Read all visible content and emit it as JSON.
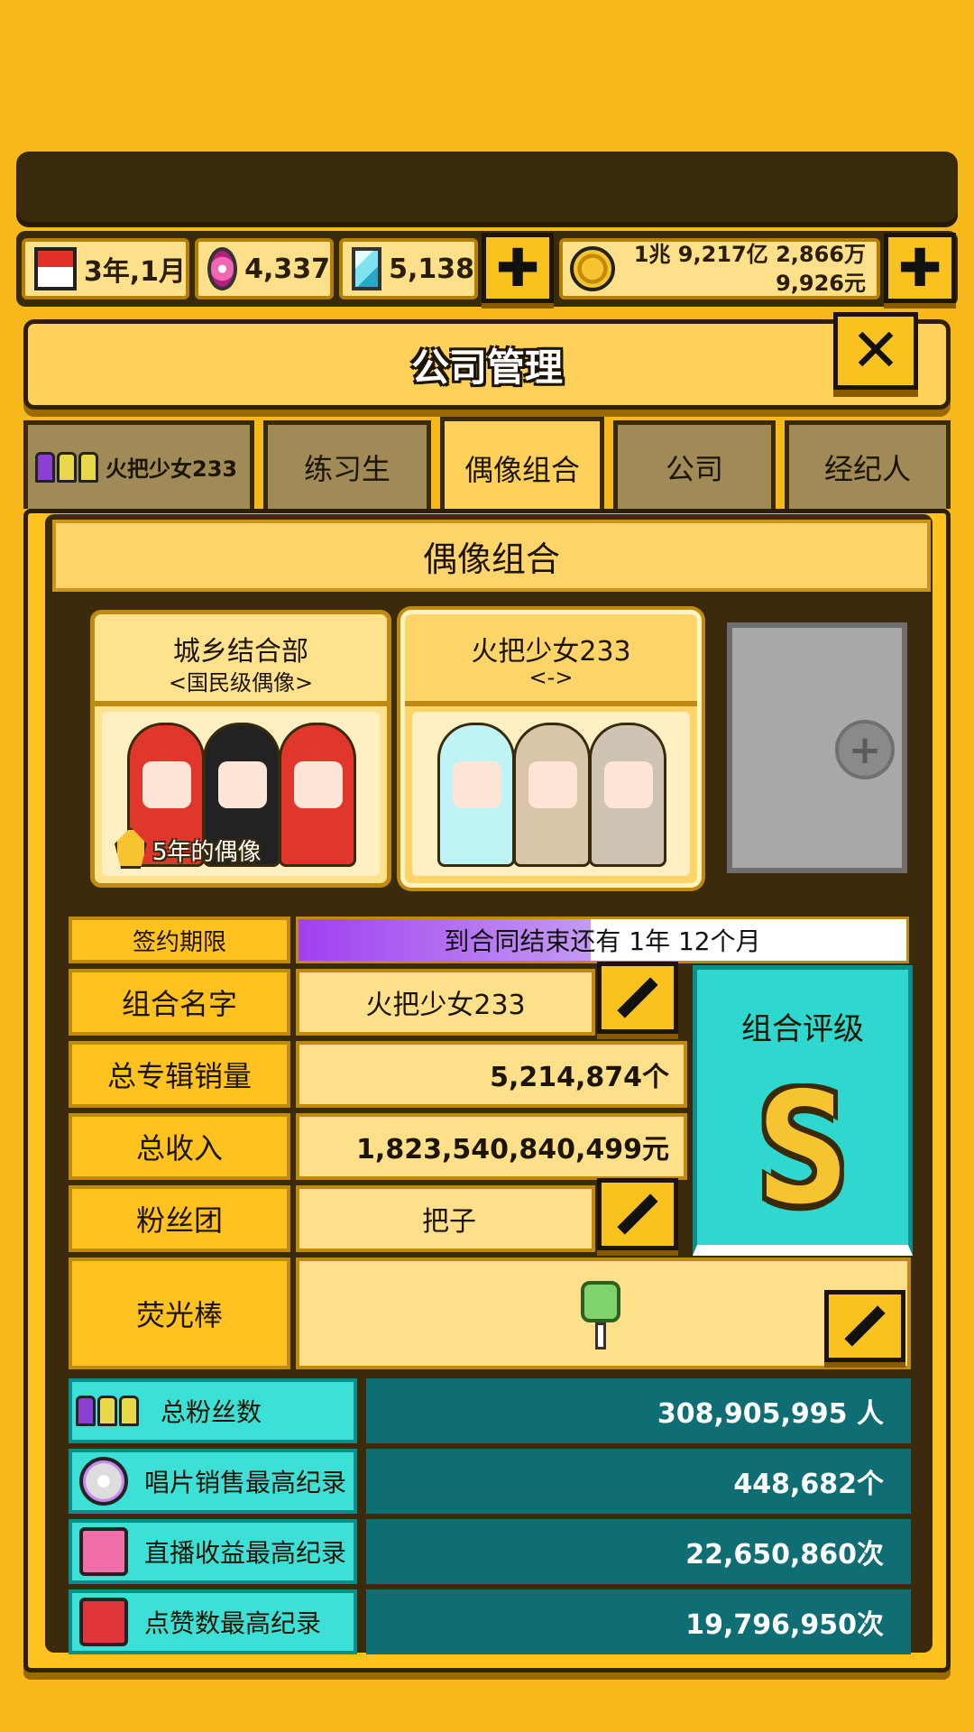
{
  "resources": {
    "date": "3年,1月",
    "gems": "4,337",
    "diamonds": "5,138",
    "money_line1": "1兆 9,217亿 2,866万",
    "money_line2": "9,926元",
    "plus": "✚"
  },
  "window": {
    "title": "公司管理",
    "close": "✕"
  },
  "tabs": [
    {
      "label": "火把少女233"
    },
    {
      "label": "练习生"
    },
    {
      "label": "偶像组合"
    },
    {
      "label": "公司"
    },
    {
      "label": "经纪人"
    }
  ],
  "section_title": "偶像组合",
  "groups": [
    {
      "name": "城乡结合部",
      "rank": "<国民级偶像>",
      "badge": "5年的偶像"
    },
    {
      "name": "火把少女233",
      "rank": "<->"
    }
  ],
  "empty_slot": "+",
  "contract": {
    "label": "签约期限",
    "text": "到合同结束还有 1年 12个月",
    "remaining_fraction": 0.48
  },
  "info": {
    "group_name_label": "组合名字",
    "group_name_value": "火把少女233",
    "album_sales_label": "总专辑销量",
    "album_sales_value": "5,214,874个",
    "income_label": "总收入",
    "income_value": "1,823,540,840,499元",
    "fanclub_label": "粉丝团",
    "fanclub_value": "把子",
    "lightstick_label": "荧光棒"
  },
  "rating": {
    "label": "组合评级",
    "grade": "S"
  },
  "stats": [
    {
      "label": "总粉丝数",
      "value": "308,905,995 人"
    },
    {
      "label": "唱片销售最高纪录",
      "value": "448,682个"
    },
    {
      "label": "直播收益最高纪录",
      "value": "22,650,860次"
    },
    {
      "label": "点赞数最高纪录",
      "value": "19,796,950次"
    }
  ],
  "colors": {
    "background": "#F6B81A",
    "panel": "#FFC21E",
    "teal": "#2ED8CE",
    "dark_teal": "#0F6E74",
    "contract_fill": "#A040F0"
  }
}
